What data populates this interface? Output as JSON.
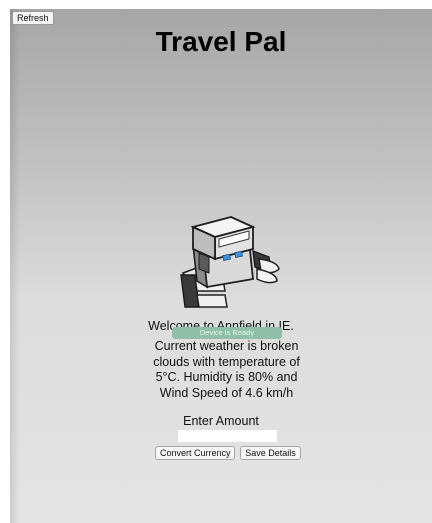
{
  "app": {
    "title": "Travel Pal",
    "refresh_label": "Refresh",
    "logo_icon": "robot-traveler-icon"
  },
  "status": {
    "welcome_text": "Welcome to Annfield in IE.",
    "device_badge": "Device is Ready",
    "weather_text": "Current weather is broken clouds with temperature of 5°C. Humidity is 80% and Wind Speed of 4.6 km/h"
  },
  "converter": {
    "amount_label": "Enter Amount",
    "amount_value": "",
    "amount_placeholder": "",
    "convert_label": "Convert Currency",
    "save_label": "Save Details"
  },
  "colors": {
    "badge": "#8fbfa9",
    "background_top": "#a6a6a6",
    "background_bottom": "#e4e4e4"
  }
}
